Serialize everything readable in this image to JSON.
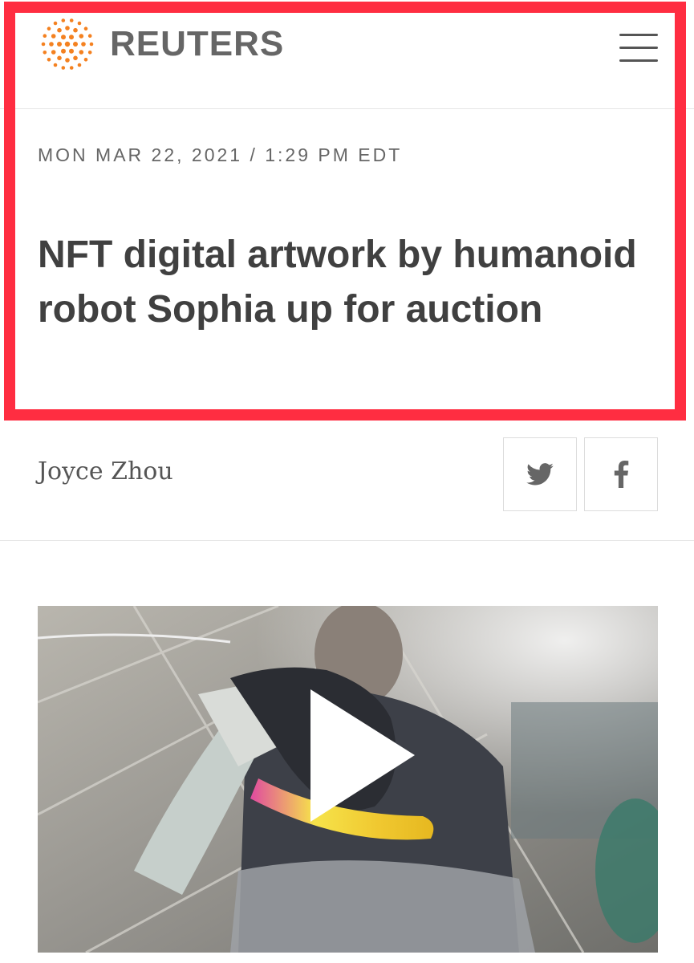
{
  "header": {
    "logo_text": "REUTERS",
    "logo_color": "#f48120",
    "menu_icon": "hamburger-menu-icon"
  },
  "article": {
    "dateline": "MON MAR 22, 2021 / 1:29 PM EDT",
    "headline": "NFT digital artwork by humanoid robot Sophia up for auction",
    "author": "Joyce Zhou"
  },
  "share": {
    "twitter_icon": "twitter-icon",
    "facebook_icon": "facebook-icon"
  },
  "video": {
    "play_icon": "play-icon"
  },
  "colors": {
    "highlight": "#ff2d41",
    "headline_text": "#404040"
  }
}
